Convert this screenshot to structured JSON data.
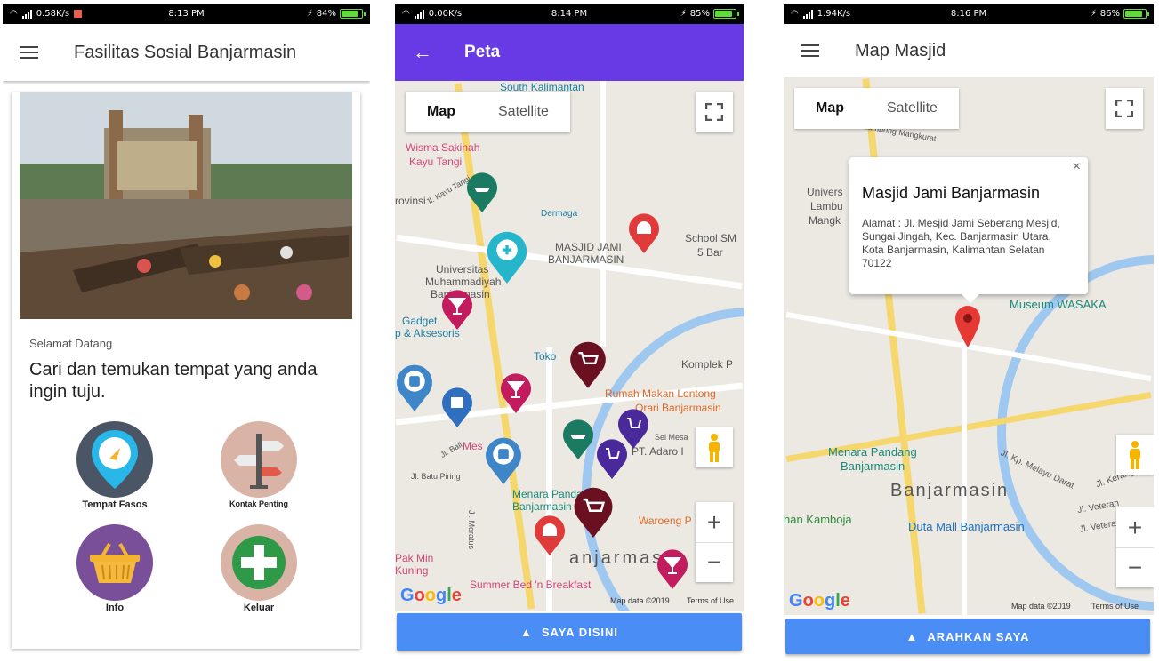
{
  "screen1": {
    "status": {
      "speed": "0.58K/s",
      "time": "8:13 PM",
      "battery": "84%"
    },
    "title": "Fasilitas Sosial Banjarmasin",
    "welcome": "Selamat Datang",
    "headline": "Cari dan temukan tempat yang anda ingin tuju.",
    "tiles": [
      {
        "label": "Tempat Fasos",
        "icon": "map-pin-icon",
        "color": "#4a5566"
      },
      {
        "label": "Kontak Penting",
        "icon": "signpost-icon",
        "color": "#d8b3a6"
      },
      {
        "label": "Info",
        "icon": "basket-icon",
        "color": "#7a4f9a"
      },
      {
        "label": "Keluar",
        "icon": "plus-icon",
        "color": "#d8b3a6"
      }
    ]
  },
  "screen2": {
    "status": {
      "speed": "0.00K/s",
      "time": "8:14 PM",
      "battery": "85%"
    },
    "title": "Peta",
    "map_types": [
      "Map",
      "Satellite"
    ],
    "labels": [
      "South Kalimantan",
      "Wisma Sakinah",
      "Kayu Tangi",
      "Dermaga",
      "MASJID JAMI",
      "BANJARMASIN",
      "School SM",
      "5 Bar",
      "Universitas",
      "Muhammadiyah",
      "Banjarmasin",
      "Gadget",
      "p & Aksesoris",
      "Toko",
      "Komplek P",
      "Rumah Makan Lontong",
      "Orari Banjarmasin",
      "PT. Adaro I",
      "Sei Mesa",
      "Menara Pandan",
      "Banjarmasin",
      "Waroeng P",
      "Pak Min",
      "Kuning",
      "Summer Bed 'n Breakfast",
      "Jl. Batu Piring",
      "Jl. Meratus",
      "Jl. Kayu Tangi",
      "rovinsi",
      "Mes",
      "Jl. Bali",
      "anjarmas"
    ],
    "footer": "Map data ©2019",
    "terms": "Terms of Use",
    "google": [
      "G",
      "o",
      "o",
      "g",
      "l",
      "e"
    ],
    "button": "SAYA DISINI"
  },
  "screen3": {
    "status": {
      "speed": "1.94K/s",
      "time": "8:16 PM",
      "battery": "86%"
    },
    "title": "Map Masjid",
    "map_types": [
      "Map",
      "Satellite"
    ],
    "info": {
      "title": "Masjid Jami Banjarmasin",
      "address": "Alamat : Jl. Mesjid Jami Seberang Mesjid, Sungai Jingah, Kec. Banjarmasin Utara, Kota Banjarmasin, Kalimantan Selatan 70122",
      "close": "×"
    },
    "labels": [
      "Univers",
      "Lambu",
      "Mangk",
      "Museum WASAKA",
      "Menara Pandang",
      "Banjarmasin",
      "Banjarmasin",
      "Jl. Kp. Melayu Darat",
      "Jl. Kerang",
      "Jl. Veteran",
      "Jl. Veteran Sun",
      "Duta Mall Banjarmasin",
      "han Kamboja",
      "Jl. Lambung Mangkurat"
    ],
    "footer": "Map data ©2019",
    "terms": "Terms of Use",
    "google": [
      "G",
      "o",
      "o",
      "g",
      "l",
      "e"
    ],
    "button": "ARAHKAN SAYA"
  }
}
